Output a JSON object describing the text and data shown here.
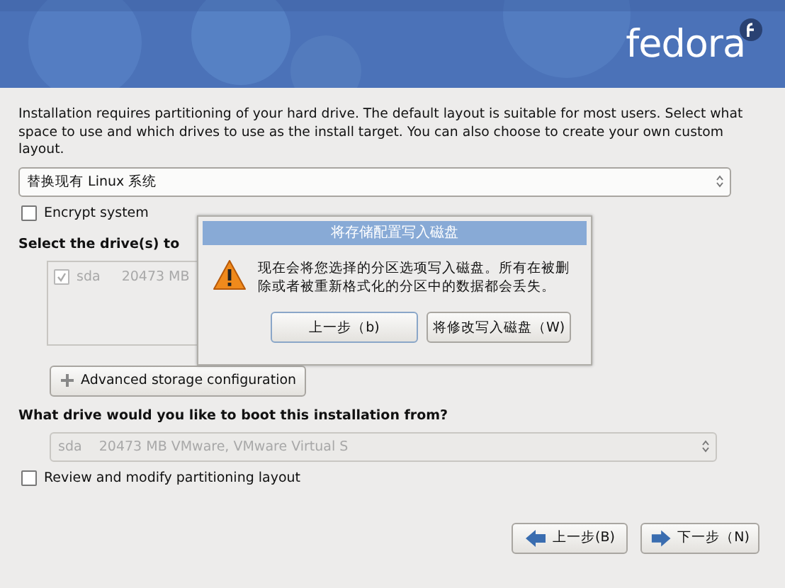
{
  "header": {
    "logo": "fedora"
  },
  "intro": "Installation requires partitioning of your hard drive.  The default layout is suitable for most users.  Select what space to use and which drives to use as the install target. You can also choose to create your own custom layout.",
  "layout_select": {
    "value": "替换现有 Linux 系统"
  },
  "encrypt": {
    "label": "Encrypt system",
    "checked": false
  },
  "drives_heading": "Select the drive(s) to",
  "drives": [
    {
      "name": "sda",
      "size": "20473 MB",
      "checked": true,
      "disabled": true
    }
  ],
  "advanced_button": "Advanced storage configuration",
  "boot_heading": "What drive would you like to boot this installation from?",
  "boot_select": {
    "value": "sda    20473 MB VMware, VMware Virtual S",
    "disabled": true
  },
  "review": {
    "label": "Review and modify partitioning layout",
    "checked": false
  },
  "buttons": [
    {
      "label": "上一步(B)",
      "kind": "back"
    },
    {
      "label": "下一步（N)",
      "kind": "next"
    }
  ],
  "dialog": {
    "title": "将存储配置写入磁盘",
    "message": "现在会将您选择的分区选项写入磁盘。所有在被删除或者被重新格式化的分区中的数据都会丢失。",
    "buttons": [
      {
        "label": "上一步（b)",
        "selected": true
      },
      {
        "label": "将修改写入磁盘（W)",
        "selected": false
      }
    ]
  }
}
